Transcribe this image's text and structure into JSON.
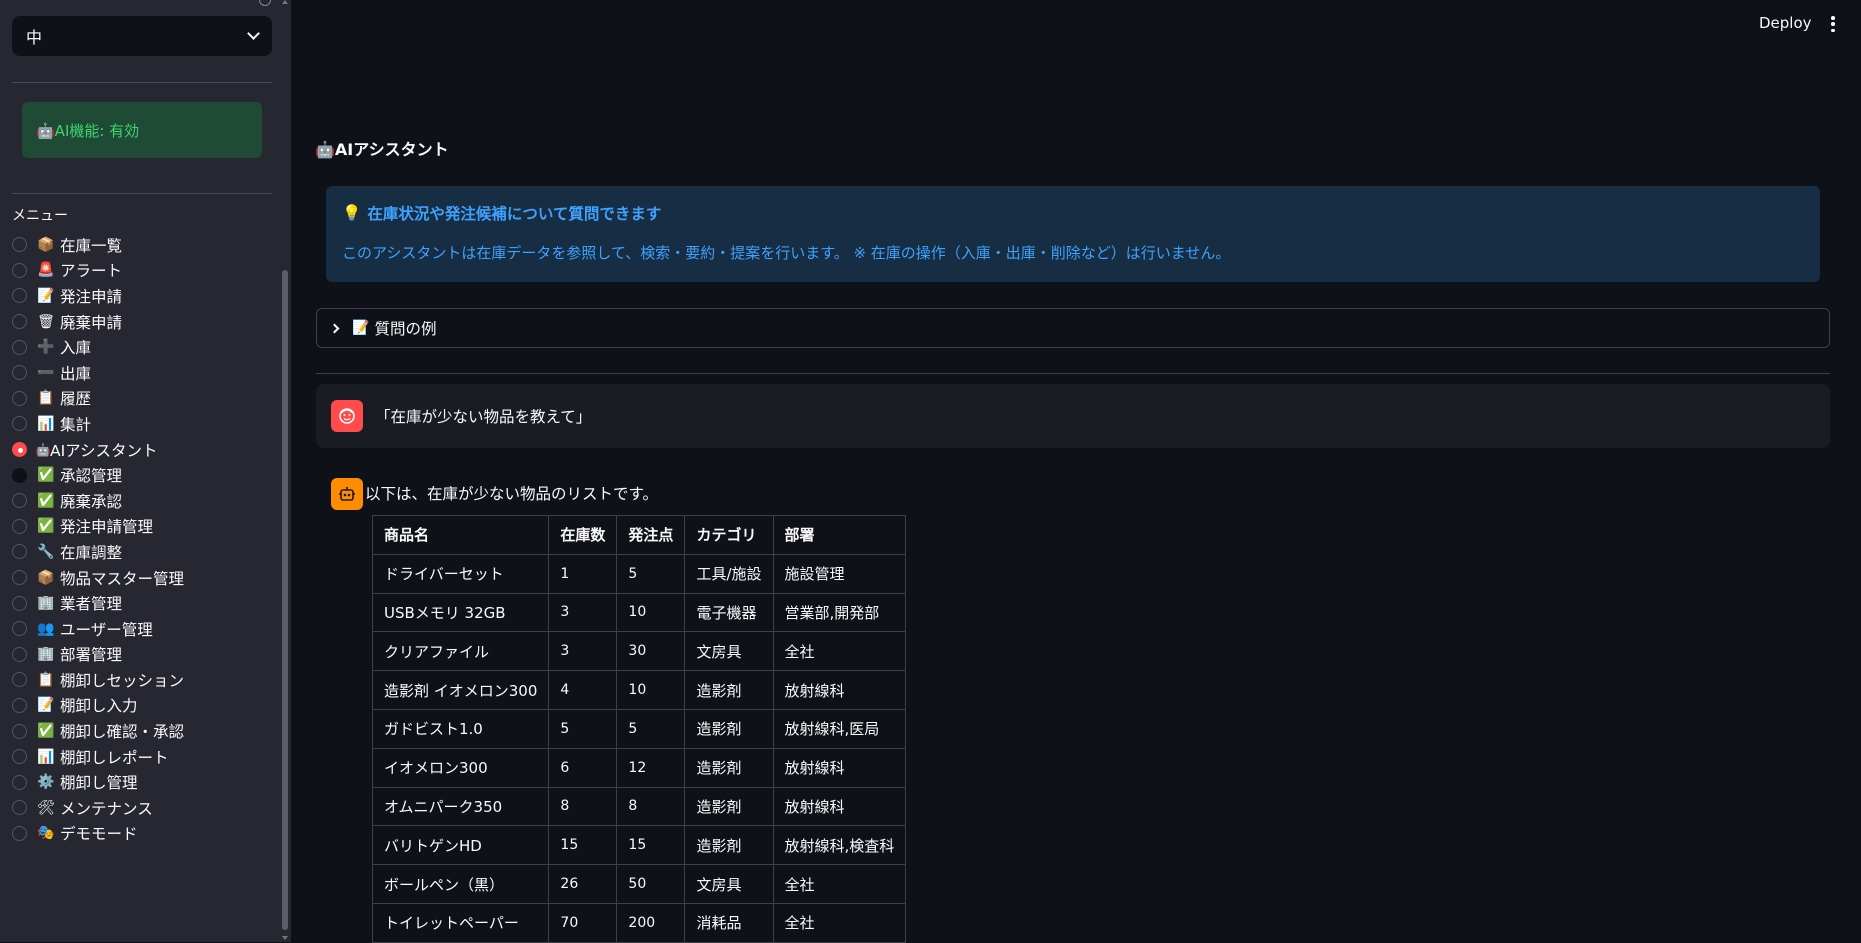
{
  "sidebar": {
    "language_select": {
      "value": "中"
    },
    "ai_status": "🤖AI機能: 有効",
    "menu_label": "メニュー",
    "items": [
      {
        "icon": "📦",
        "label": "在庫一覧",
        "state": "none"
      },
      {
        "icon": "🚨",
        "label": "アラート",
        "state": "none"
      },
      {
        "icon": "📝",
        "label": "発注申請",
        "state": "none"
      },
      {
        "icon": "🗑",
        "label": "廃棄申請",
        "state": "none"
      },
      {
        "icon": "➕",
        "label": "入庫",
        "state": "none"
      },
      {
        "icon": "➖",
        "label": "出庫",
        "state": "none"
      },
      {
        "icon": "📋",
        "label": "履歴",
        "state": "none"
      },
      {
        "icon": "📊",
        "label": "集計",
        "state": "none"
      },
      {
        "icon": "🤖",
        "label": "AIアシスタント",
        "state": "selected"
      },
      {
        "icon": "✅",
        "label": "承認管理",
        "state": "dark"
      },
      {
        "icon": "✅",
        "label": "廃棄承認",
        "state": "none"
      },
      {
        "icon": "✅",
        "label": "発注申請管理",
        "state": "none"
      },
      {
        "icon": "🔧",
        "label": "在庫調整",
        "state": "none"
      },
      {
        "icon": "📦",
        "label": "物品マスター管理",
        "state": "none"
      },
      {
        "icon": "🏢",
        "label": "業者管理",
        "state": "none"
      },
      {
        "icon": "👥",
        "label": "ユーザー管理",
        "state": "none"
      },
      {
        "icon": "🏢",
        "label": "部署管理",
        "state": "none"
      },
      {
        "icon": "📋",
        "label": "棚卸しセッション",
        "state": "none"
      },
      {
        "icon": "📝",
        "label": "棚卸し入力",
        "state": "none"
      },
      {
        "icon": "✅",
        "label": "棚卸し確認・承認",
        "state": "none"
      },
      {
        "icon": "📊",
        "label": "棚卸しレポート",
        "state": "none"
      },
      {
        "icon": "⚙️",
        "label": "棚卸し管理",
        "state": "none"
      },
      {
        "icon": "🛠",
        "label": "メンテナンス",
        "state": "none"
      },
      {
        "icon": "🎭",
        "label": "デモモード",
        "state": "none"
      }
    ]
  },
  "header": {
    "deploy_label": "Deploy"
  },
  "main": {
    "title": "🤖AIアシスタント",
    "info": {
      "icon": "💡",
      "title": "在庫状況や発注候補について質問できます",
      "text": "このアシスタントは在庫データを参照して、検索・要約・提案を行います。 ※ 在庫の操作（入庫・出庫・削除など）は行いません。"
    },
    "expander": {
      "icon": "📝",
      "label": "質問の例"
    },
    "user_message": "「在庫が少ない物品を教えて」",
    "assistant_message": "以下は、在庫が少ない物品のリストです。",
    "table": {
      "headers": [
        "商品名",
        "在庫数",
        "発注点",
        "カテゴリ",
        "部署"
      ],
      "rows": [
        [
          "ドライバーセット",
          "1",
          "5",
          "工具/施設",
          "施設管理"
        ],
        [
          "USBメモリ 32GB",
          "3",
          "10",
          "電子機器",
          "営業部,開発部"
        ],
        [
          "クリアファイル",
          "3",
          "30",
          "文房具",
          "全社"
        ],
        [
          "造影剤 イオメロン300",
          "4",
          "10",
          "造影剤",
          "放射線科"
        ],
        [
          "ガドビスト1.0",
          "5",
          "5",
          "造影剤",
          "放射線科,医局"
        ],
        [
          "イオメロン300",
          "6",
          "12",
          "造影剤",
          "放射線科"
        ],
        [
          "オムニパーク350",
          "8",
          "8",
          "造影剤",
          "放射線科"
        ],
        [
          "バリトゲンHD",
          "15",
          "15",
          "造影剤",
          "放射線科,検査科"
        ],
        [
          "ボールペン（黒）",
          "26",
          "50",
          "文房具",
          "全社"
        ],
        [
          "トイレットペーパー",
          "70",
          "200",
          "消耗品",
          "全社"
        ]
      ]
    }
  }
}
